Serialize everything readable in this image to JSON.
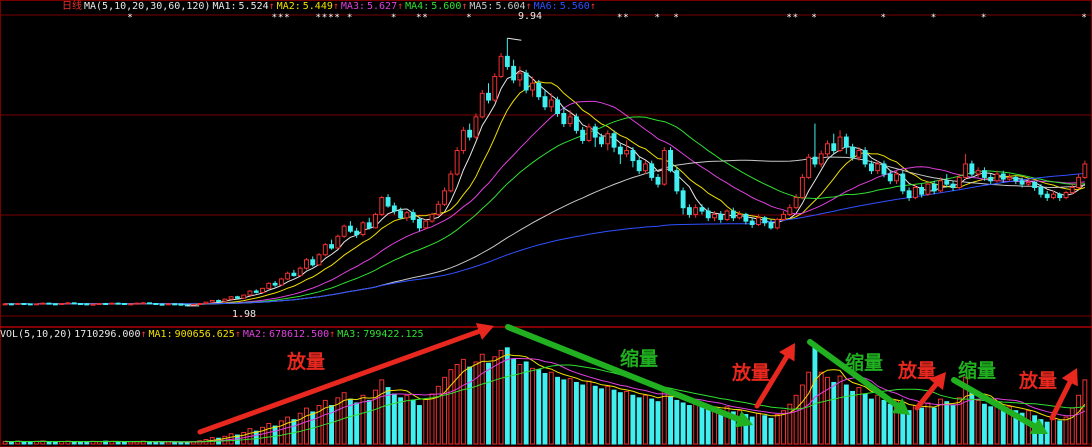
{
  "price_header": {
    "period": "日线",
    "ma_spec": "MA(5,10,20,30,60,120)",
    "items": [
      {
        "label": "MA1:",
        "value": "5.524",
        "arrow": "↑",
        "color": "#e8e8e8"
      },
      {
        "label": "MA2:",
        "value": "5.449",
        "arrow": "↑",
        "color": "#f0e000"
      },
      {
        "label": "MA3:",
        "value": "5.627",
        "arrow": "↑",
        "color": "#e040e0"
      },
      {
        "label": "MA4:",
        "value": "5.600",
        "arrow": "↑",
        "color": "#30e030"
      },
      {
        "label": "MA5:",
        "value": "5.604",
        "arrow": "↑",
        "color": "#c8c8c8"
      },
      {
        "label": "MA6:",
        "value": "5.560",
        "arrow": "↑",
        "color": "#3050ff"
      }
    ]
  },
  "vol_header": {
    "spec": "VOL(5,10,20)",
    "value": "1710296.000",
    "arrow": "↑",
    "items": [
      {
        "label": "MA1:",
        "value": "900656.625",
        "arrow": "↑",
        "color": "#f0e000"
      },
      {
        "label": "MA2:",
        "value": "678612.500",
        "arrow": "↑",
        "color": "#e040e0"
      },
      {
        "label": "MA3:",
        "value": "799422.125",
        "arrow": "",
        "color": "#30e030"
      }
    ]
  },
  "price_markers": {
    "high": "9.94",
    "low": "1.98"
  },
  "annotations": [
    {
      "text": "放量",
      "color": "#e8281e"
    },
    {
      "text": "缩量",
      "color": "#20b020"
    },
    {
      "text": "放量",
      "color": "#e8281e"
    },
    {
      "text": "缩量",
      "color": "#20b020"
    },
    {
      "text": "放量",
      "color": "#e8281e"
    },
    {
      "text": "缩量",
      "color": "#20b020"
    },
    {
      "text": "放量",
      "color": "#e8281e"
    }
  ],
  "colors": {
    "up": "#f03030",
    "down": "#40f0f0",
    "grid": "#7a0000",
    "ma_price": [
      "#e8e8e8",
      "#f0e000",
      "#e040e0",
      "#30e030",
      "#c8c8c8",
      "#3050ff"
    ],
    "ma_vol": [
      "#f0e000",
      "#e040e0",
      "#30e030"
    ],
    "arrow_red": "#e8281e",
    "arrow_green": "#20b020"
  },
  "chart_data": {
    "type": "candlestick",
    "ylim": [
      1.5,
      10.6
    ],
    "candles": [
      [
        2.02,
        2.04,
        2.06,
        2.01
      ],
      [
        2.04,
        2.03,
        2.06,
        2.01
      ],
      [
        2.03,
        2.05,
        2.07,
        2.02
      ],
      [
        2.05,
        2.04,
        2.06,
        2.02
      ],
      [
        2.04,
        2.02,
        2.05,
        2.0
      ],
      [
        2.02,
        2.04,
        2.05,
        2.01
      ],
      [
        2.04,
        2.06,
        2.08,
        2.03
      ],
      [
        2.06,
        2.04,
        2.07,
        2.02
      ],
      [
        2.04,
        2.03,
        2.05,
        2.01
      ],
      [
        2.03,
        2.05,
        2.06,
        2.02
      ],
      [
        2.05,
        2.07,
        2.09,
        2.04
      ],
      [
        2.07,
        2.05,
        2.08,
        2.04
      ],
      [
        2.05,
        2.04,
        2.06,
        2.03
      ],
      [
        2.04,
        2.02,
        2.05,
        2.0
      ],
      [
        2.02,
        2.03,
        2.05,
        2.01
      ],
      [
        2.03,
        2.05,
        2.06,
        2.02
      ],
      [
        2.05,
        2.04,
        2.07,
        2.03
      ],
      [
        2.04,
        2.06,
        2.07,
        2.03
      ],
      [
        2.06,
        2.05,
        2.08,
        2.04
      ],
      [
        2.05,
        2.03,
        2.06,
        2.02
      ],
      [
        2.03,
        2.04,
        2.05,
        2.01
      ],
      [
        2.04,
        2.06,
        2.08,
        2.03
      ],
      [
        2.06,
        2.07,
        2.09,
        2.05
      ],
      [
        2.07,
        2.05,
        2.08,
        2.04
      ],
      [
        2.05,
        2.03,
        2.06,
        2.01
      ],
      [
        2.03,
        2.02,
        2.04,
        2.0
      ],
      [
        2.02,
        2.04,
        2.05,
        2.01
      ],
      [
        2.04,
        2.03,
        2.05,
        2.01
      ],
      [
        2.03,
        2.01,
        2.04,
        1.99
      ],
      [
        2.01,
        2.0,
        2.03,
        1.98
      ],
      [
        2.0,
        2.02,
        2.03,
        1.99
      ],
      [
        2.02,
        2.05,
        2.06,
        2.01
      ],
      [
        2.05,
        2.09,
        2.1,
        2.04
      ],
      [
        2.09,
        2.14,
        2.15,
        2.08
      ],
      [
        2.14,
        2.12,
        2.17,
        2.1
      ],
      [
        2.12,
        2.18,
        2.2,
        2.11
      ],
      [
        2.18,
        2.25,
        2.27,
        2.16
      ],
      [
        2.25,
        2.21,
        2.28,
        2.19
      ],
      [
        2.21,
        2.3,
        2.32,
        2.2
      ],
      [
        2.3,
        2.42,
        2.45,
        2.28
      ],
      [
        2.42,
        2.38,
        2.47,
        2.35
      ],
      [
        2.38,
        2.5,
        2.52,
        2.36
      ],
      [
        2.5,
        2.65,
        2.68,
        2.48
      ],
      [
        2.65,
        2.6,
        2.72,
        2.55
      ],
      [
        2.6,
        2.78,
        2.82,
        2.58
      ],
      [
        2.78,
        2.95,
        3.0,
        2.75
      ],
      [
        2.95,
        2.88,
        3.05,
        2.85
      ],
      [
        2.88,
        3.1,
        3.15,
        2.86
      ],
      [
        3.1,
        3.35,
        3.4,
        3.05
      ],
      [
        3.35,
        3.2,
        3.45,
        3.15
      ],
      [
        3.2,
        3.5,
        3.55,
        3.18
      ],
      [
        3.5,
        3.8,
        3.85,
        3.45
      ],
      [
        3.8,
        3.7,
        3.95,
        3.65
      ],
      [
        3.7,
        4.05,
        4.1,
        3.68
      ],
      [
        4.05,
        4.35,
        4.4,
        4.0
      ],
      [
        4.35,
        4.2,
        4.5,
        4.15
      ],
      [
        4.2,
        4.1,
        4.3,
        4.0
      ],
      [
        4.1,
        4.45,
        4.5,
        4.05
      ],
      [
        4.45,
        4.3,
        4.6,
        4.25
      ],
      [
        4.3,
        4.7,
        4.75,
        4.28
      ],
      [
        4.7,
        5.2,
        5.25,
        4.65
      ],
      [
        5.2,
        4.95,
        5.3,
        4.9
      ],
      [
        4.95,
        4.8,
        5.05,
        4.7
      ],
      [
        4.8,
        4.6,
        4.9,
        4.55
      ],
      [
        4.6,
        4.75,
        4.8,
        4.5
      ],
      [
        4.75,
        4.55,
        4.85,
        4.45
      ],
      [
        4.55,
        4.3,
        4.6,
        4.2
      ],
      [
        4.3,
        4.5,
        4.55,
        4.25
      ],
      [
        4.5,
        4.7,
        4.75,
        4.45
      ],
      [
        4.7,
        5.0,
        5.1,
        4.65
      ],
      [
        5.0,
        5.4,
        5.5,
        4.95
      ],
      [
        5.4,
        5.9,
        6.0,
        5.35
      ],
      [
        5.9,
        6.6,
        6.7,
        5.85
      ],
      [
        6.6,
        7.2,
        7.3,
        6.5
      ],
      [
        7.2,
        7.0,
        7.4,
        6.9
      ],
      [
        7.0,
        7.6,
        7.7,
        6.95
      ],
      [
        7.6,
        8.3,
        8.4,
        7.55
      ],
      [
        8.3,
        8.1,
        8.6,
        8.0
      ],
      [
        8.1,
        8.8,
        8.9,
        8.05
      ],
      [
        8.8,
        9.4,
        9.5,
        8.75
      ],
      [
        9.4,
        9.1,
        9.94,
        9.0
      ],
      [
        9.1,
        8.7,
        9.3,
        8.6
      ],
      [
        8.7,
        8.9,
        9.1,
        8.5
      ],
      [
        8.9,
        8.4,
        9.0,
        8.3
      ],
      [
        8.4,
        8.6,
        8.8,
        8.2
      ],
      [
        8.6,
        8.2,
        8.7,
        8.1
      ],
      [
        8.2,
        7.9,
        8.4,
        7.8
      ],
      [
        7.9,
        8.1,
        8.3,
        7.75
      ],
      [
        8.1,
        7.7,
        8.2,
        7.6
      ],
      [
        7.7,
        7.4,
        7.9,
        7.3
      ],
      [
        7.4,
        7.6,
        7.8,
        7.3
      ],
      [
        7.6,
        7.2,
        7.7,
        7.1
      ],
      [
        7.2,
        6.9,
        7.3,
        6.8
      ],
      [
        6.9,
        7.3,
        7.4,
        6.85
      ],
      [
        7.3,
        7.0,
        7.4,
        6.7
      ],
      [
        7.0,
        6.8,
        7.1,
        6.7
      ],
      [
        6.8,
        7.1,
        7.2,
        6.6
      ],
      [
        7.1,
        6.7,
        7.2,
        6.55
      ],
      [
        6.7,
        6.5,
        6.8,
        6.2
      ],
      [
        6.5,
        6.6,
        6.9,
        6.4
      ],
      [
        6.6,
        6.3,
        6.7,
        6.1
      ],
      [
        6.3,
        6.0,
        6.4,
        5.9
      ],
      [
        6.0,
        6.2,
        6.3,
        5.9
      ],
      [
        6.2,
        5.8,
        6.3,
        5.7
      ],
      [
        5.8,
        5.6,
        5.9,
        5.5
      ],
      [
        5.6,
        6.6,
        6.7,
        5.55
      ],
      [
        6.6,
        6.0,
        6.7,
        5.95
      ],
      [
        6.0,
        5.4,
        6.1,
        5.3
      ],
      [
        5.4,
        4.9,
        5.5,
        4.7
      ],
      [
        4.9,
        4.7,
        5.0,
        4.6
      ],
      [
        4.7,
        4.9,
        5.0,
        4.6
      ],
      [
        4.9,
        4.8,
        5.0,
        4.7
      ],
      [
        4.8,
        4.6,
        4.9,
        4.5
      ],
      [
        4.6,
        4.7,
        4.8,
        4.5
      ],
      [
        4.7,
        4.55,
        4.8,
        4.45
      ],
      [
        4.55,
        4.8,
        4.85,
        4.5
      ],
      [
        4.8,
        4.6,
        4.9,
        4.5
      ],
      [
        4.6,
        4.7,
        4.8,
        4.55
      ],
      [
        4.7,
        4.5,
        4.75,
        4.4
      ],
      [
        4.5,
        4.4,
        4.6,
        4.3
      ],
      [
        4.4,
        4.6,
        4.7,
        4.35
      ],
      [
        4.6,
        4.45,
        4.65,
        4.35
      ],
      [
        4.45,
        4.3,
        4.55,
        4.25
      ],
      [
        4.3,
        4.55,
        4.6,
        4.25
      ],
      [
        4.55,
        4.7,
        4.8,
        4.5
      ],
      [
        4.7,
        4.9,
        5.0,
        4.65
      ],
      [
        4.9,
        5.2,
        5.3,
        4.85
      ],
      [
        5.2,
        5.8,
        5.9,
        5.15
      ],
      [
        5.8,
        6.4,
        6.5,
        5.75
      ],
      [
        6.4,
        6.2,
        7.4,
        6.1
      ],
      [
        6.2,
        6.5,
        6.6,
        6.1
      ],
      [
        6.5,
        6.8,
        6.9,
        6.4
      ],
      [
        6.8,
        6.6,
        7.1,
        6.5
      ],
      [
        6.6,
        7.0,
        7.2,
        6.55
      ],
      [
        7.0,
        6.7,
        7.1,
        6.5
      ],
      [
        6.7,
        6.4,
        6.8,
        6.3
      ],
      [
        6.4,
        6.6,
        6.7,
        6.3
      ],
      [
        6.6,
        6.2,
        6.7,
        6.1
      ],
      [
        6.2,
        6.0,
        6.3,
        5.9
      ],
      [
        6.0,
        6.2,
        6.3,
        5.9
      ],
      [
        6.2,
        5.9,
        6.3,
        5.8
      ],
      [
        5.9,
        5.7,
        6.0,
        5.6
      ],
      [
        5.7,
        5.9,
        6.0,
        5.6
      ],
      [
        5.9,
        5.4,
        6.0,
        5.3
      ],
      [
        5.4,
        5.2,
        5.5,
        5.1
      ],
      [
        5.2,
        5.5,
        5.6,
        5.15
      ],
      [
        5.5,
        5.3,
        5.6,
        5.2
      ],
      [
        5.3,
        5.6,
        5.7,
        5.25
      ],
      [
        5.6,
        5.4,
        5.7,
        5.3
      ],
      [
        5.4,
        5.7,
        5.8,
        5.35
      ],
      [
        5.7,
        5.6,
        5.9,
        5.5
      ],
      [
        5.6,
        5.5,
        5.7,
        5.4
      ],
      [
        5.5,
        5.8,
        5.9,
        5.45
      ],
      [
        5.8,
        6.2,
        6.5,
        5.75
      ],
      [
        6.2,
        5.9,
        6.3,
        5.8
      ],
      [
        5.9,
        6.0,
        6.1,
        5.8
      ],
      [
        6.0,
        5.8,
        6.1,
        5.7
      ],
      [
        5.8,
        5.7,
        5.9,
        5.6
      ],
      [
        5.7,
        5.9,
        6.0,
        5.65
      ],
      [
        5.9,
        5.75,
        6.0,
        5.65
      ],
      [
        5.75,
        5.8,
        5.9,
        5.7
      ],
      [
        5.8,
        5.7,
        5.85,
        5.6
      ],
      [
        5.7,
        5.6,
        5.8,
        5.5
      ],
      [
        5.6,
        5.65,
        5.75,
        5.55
      ],
      [
        5.65,
        5.5,
        5.7,
        5.4
      ],
      [
        5.5,
        5.3,
        5.6,
        5.2
      ],
      [
        5.3,
        5.2,
        5.4,
        5.1
      ],
      [
        5.2,
        5.3,
        5.4,
        5.15
      ],
      [
        5.3,
        5.2,
        5.35,
        5.1
      ],
      [
        5.2,
        5.35,
        5.4,
        5.15
      ],
      [
        5.35,
        5.5,
        5.6,
        5.3
      ],
      [
        5.5,
        5.8,
        5.9,
        5.45
      ],
      [
        5.8,
        6.2,
        6.3,
        5.75
      ]
    ],
    "volume": [
      0.2,
      0.18,
      0.22,
      0.19,
      0.17,
      0.21,
      0.23,
      0.18,
      0.16,
      0.2,
      0.22,
      0.19,
      0.17,
      0.18,
      0.21,
      0.2,
      0.22,
      0.19,
      0.18,
      0.16,
      0.17,
      0.2,
      0.22,
      0.18,
      0.15,
      0.14,
      0.17,
      0.16,
      0.15,
      0.14,
      0.18,
      0.25,
      0.35,
      0.5,
      0.45,
      0.6,
      0.8,
      0.7,
      0.9,
      1.2,
      1.0,
      1.3,
      1.6,
      1.4,
      1.8,
      2.1,
      1.9,
      2.4,
      2.8,
      2.5,
      3.0,
      3.4,
      3.0,
      3.6,
      4.0,
      3.5,
      3.2,
      3.8,
      3.4,
      4.2,
      5.0,
      4.4,
      3.9,
      3.6,
      3.8,
      3.4,
      3.0,
      3.5,
      3.9,
      4.5,
      5.2,
      5.8,
      6.2,
      6.6,
      6.0,
      6.4,
      7.0,
      6.3,
      6.8,
      7.3,
      7.5,
      6.6,
      6.2,
      6.4,
      5.9,
      5.8,
      5.5,
      5.6,
      5.2,
      5.0,
      5.1,
      4.8,
      4.6,
      4.9,
      4.5,
      4.3,
      4.5,
      4.2,
      4.0,
      4.1,
      3.8,
      3.6,
      3.8,
      3.5,
      3.3,
      4.4,
      3.7,
      3.4,
      3.2,
      3.0,
      3.1,
      2.9,
      2.7,
      2.8,
      2.6,
      2.9,
      2.5,
      2.6,
      2.3,
      2.1,
      2.4,
      2.2,
      2.0,
      2.3,
      2.6,
      3.1,
      3.8,
      4.6,
      5.6,
      7.8,
      5.6,
      5.2,
      4.8,
      5.3,
      4.6,
      4.1,
      4.4,
      3.9,
      3.5,
      3.8,
      3.4,
      3.1,
      3.4,
      2.9,
      2.6,
      3.0,
      2.8,
      3.2,
      2.8,
      3.5,
      3.3,
      3.0,
      3.6,
      5.2,
      4.2,
      3.4,
      3.1,
      2.9,
      3.2,
      2.8,
      2.9,
      2.6,
      2.4,
      2.6,
      2.2,
      1.9,
      1.7,
      1.9,
      1.8,
      2.1,
      2.8,
      3.8,
      5.0
    ]
  }
}
